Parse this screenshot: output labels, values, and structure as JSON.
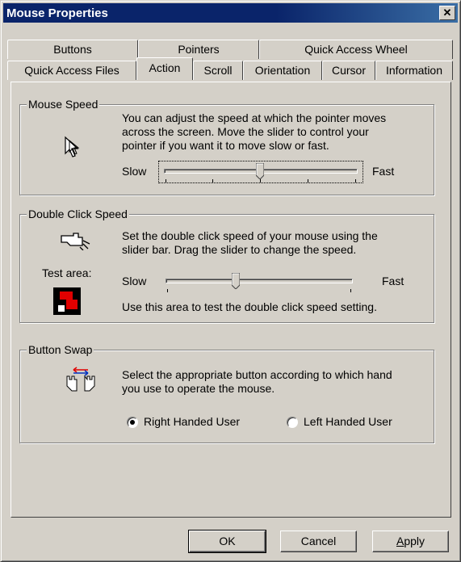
{
  "window": {
    "title": "Mouse Properties",
    "close_glyph": "✕"
  },
  "tabs_row1": [
    "Buttons",
    "Pointers",
    "Quick Access Wheel"
  ],
  "tabs_row2": [
    "Quick Access Files",
    "Action",
    "Scroll",
    "Orientation",
    "Cursor",
    "Information"
  ],
  "active_tab": "Action",
  "mouse_speed": {
    "legend": "Mouse Speed",
    "description_lines": [
      "You can adjust the speed at which the pointer moves",
      "across the screen. Move the slider to control your",
      "pointer if you want it to move slow or fast."
    ],
    "slow_label": "Slow",
    "fast_label": "Fast",
    "slider_level": 0.5
  },
  "double_click": {
    "legend": "Double Click Speed",
    "description_lines": [
      "Set the double click speed of your mouse using the",
      "slider bar. Drag the slider to change the speed."
    ],
    "test_area_label": "Test area:",
    "slow_label": "Slow",
    "fast_label": "Fast",
    "slider_level": 0.38,
    "test_hint": "Use this area to test the double click speed setting."
  },
  "button_swap": {
    "legend": "Button Swap",
    "description_lines": [
      "Select the appropriate button according to which hand",
      "you use to operate the mouse."
    ],
    "right_label": "Right Handed User",
    "left_label": "Left Handed User",
    "selected": "right"
  },
  "buttons": {
    "ok": "OK",
    "cancel": "Cancel",
    "apply": "Apply"
  },
  "colors": {
    "title_bar": "#0a246a",
    "face": "#d4d0c8",
    "test_red": "#e00000"
  }
}
